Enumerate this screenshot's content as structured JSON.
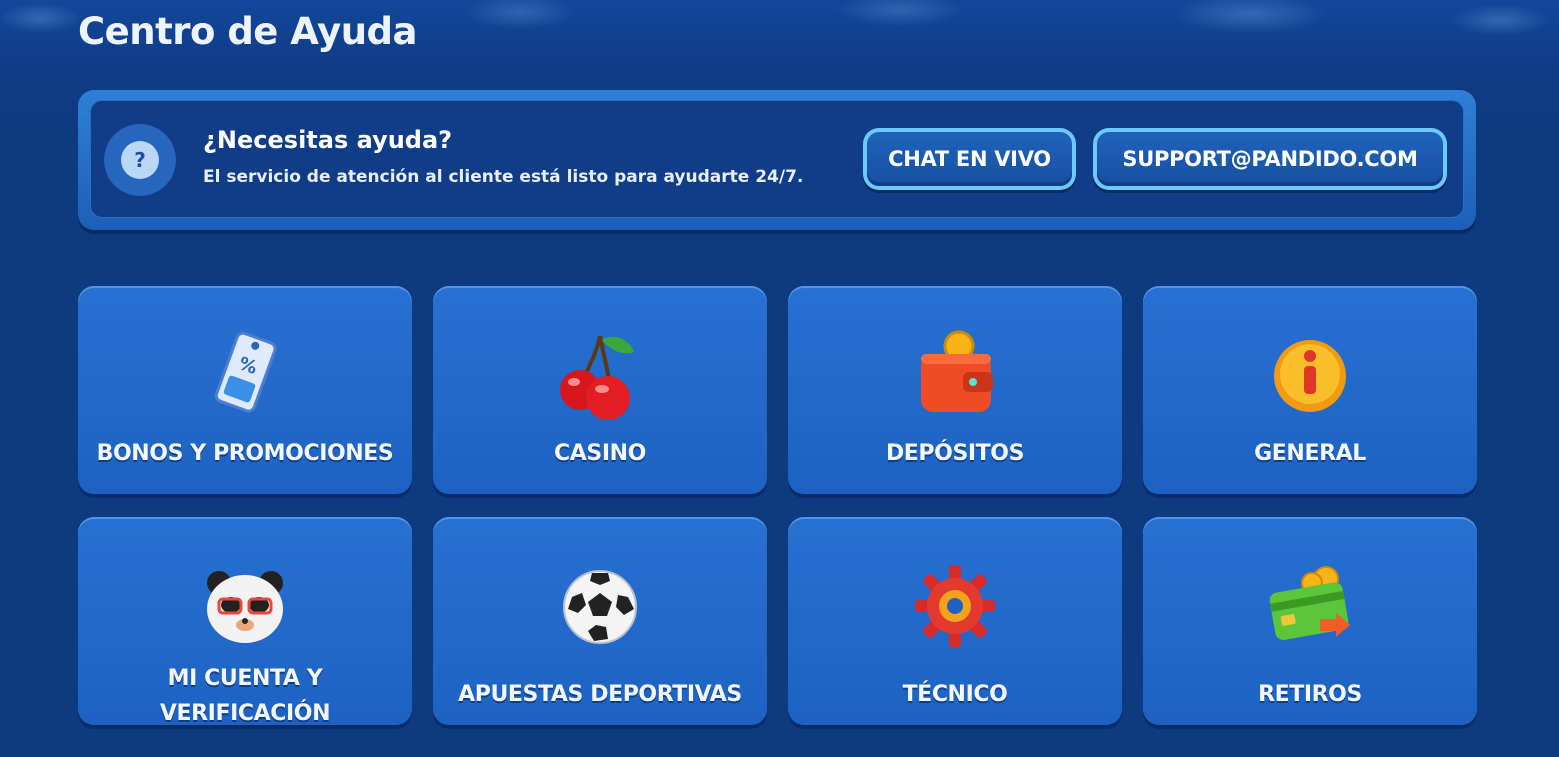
{
  "page": {
    "title": "Centro de Ayuda"
  },
  "help": {
    "icon": "question-icon",
    "heading": "¿Necesitas ayuda?",
    "subtext": "El servicio de atención al cliente está listo para ayudarte 24/7.",
    "chat_label": "CHAT EN VIVO",
    "email_label": "SUPPORT@PANDIDO.COM"
  },
  "categories": [
    {
      "label": "BONOS Y PROMOCIONES",
      "icon": "coupon-percent-icon"
    },
    {
      "label": "CASINO",
      "icon": "cherries-icon"
    },
    {
      "label": "DEPÓSITOS",
      "icon": "wallet-coin-icon"
    },
    {
      "label": "GENERAL",
      "icon": "info-coin-icon"
    },
    {
      "label_line1": "MI CUENTA Y",
      "label_line2": "VERIFICACIÓN",
      "icon": "panda-icon"
    },
    {
      "label": "APUESTAS DEPORTIVAS",
      "icon": "soccer-ball-icon"
    },
    {
      "label": "TÉCNICO",
      "icon": "gear-icon"
    },
    {
      "label": "RETIROS",
      "icon": "card-withdraw-icon"
    }
  ]
}
